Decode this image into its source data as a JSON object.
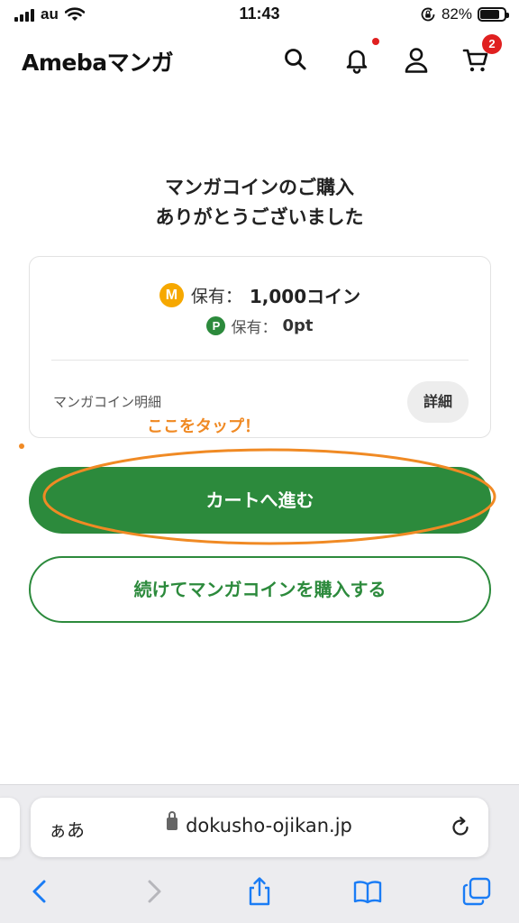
{
  "status_bar": {
    "carrier": "au",
    "time": "11:43",
    "battery_percent": "82%",
    "battery_level": 0.82
  },
  "header": {
    "logo": "Amebaマンガ",
    "cart_badge": "2"
  },
  "thanks": {
    "line1": "マンガコインのご購入",
    "line2": "ありがとうございました"
  },
  "balance_card": {
    "coin_icon": "M",
    "coin_label": "保有：",
    "coin_value": "1,000コイン",
    "point_icon": "P",
    "point_label": "保有：",
    "point_value": "0pt",
    "detail_label": "マンガコイン明細",
    "detail_button": "詳細"
  },
  "annotation": {
    "text": "ここをタップ！",
    "color": "#f08a24"
  },
  "actions": {
    "primary": "カートへ進む",
    "secondary": "続けてマンガコインを購入する"
  },
  "browser": {
    "text_size_label": "ぁあ",
    "url": "dokusho-ojikan.jp"
  },
  "colors": {
    "brand_green": "#2c8a3c",
    "coin_orange": "#f6a800",
    "badge_red": "#e02020",
    "ios_blue": "#1a7cf5"
  },
  "icons": [
    "search-icon",
    "bell-icon",
    "user-icon",
    "cart-icon",
    "lock-icon",
    "reload-icon",
    "back-icon",
    "forward-icon",
    "share-icon",
    "bookmarks-icon",
    "tabs-icon"
  ]
}
